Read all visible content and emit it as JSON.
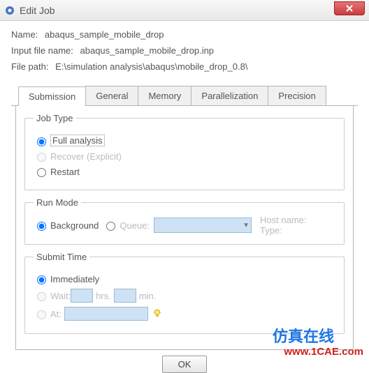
{
  "window": {
    "title": "Edit Job"
  },
  "fields": {
    "name_label": "Name:",
    "name_value": "abaqus_sample_mobile_drop",
    "input_file_label": "Input file name:",
    "input_file_value": "abaqus_sample_mobile_drop.inp",
    "file_path_label": "File path:",
    "file_path_value": "E:\\simulation analysis\\abaqus\\mobile_drop_0.8\\"
  },
  "tabs": {
    "submission": "Submission",
    "general": "General",
    "memory": "Memory",
    "parallelization": "Parallelization",
    "precision": "Precision",
    "active": "submission"
  },
  "job_type": {
    "legend": "Job Type",
    "full_analysis": "Full analysis",
    "recover": "Recover (Explicit)",
    "restart": "Restart"
  },
  "run_mode": {
    "legend": "Run Mode",
    "background": "Background",
    "queue": "Queue:",
    "host_name_label": "Host name:",
    "type_label": "Type:"
  },
  "submit_time": {
    "legend": "Submit Time",
    "immediately": "Immediately",
    "wait": "Wait:",
    "hrs": "hrs.",
    "min": "min.",
    "at": "At:"
  },
  "buttons": {
    "ok": "OK"
  },
  "watermark": {
    "zh": "仿真在线",
    "url": "www.1CAE.com"
  }
}
